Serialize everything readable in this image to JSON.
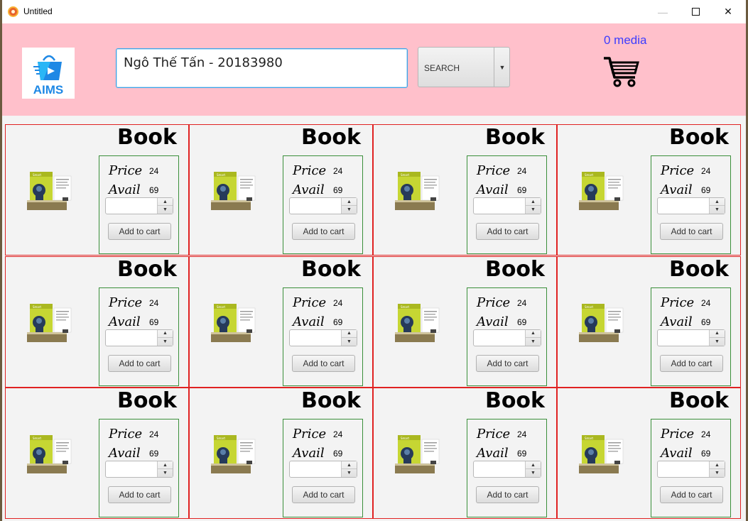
{
  "window": {
    "title": "Untitled"
  },
  "header": {
    "logo_text": "AIMS",
    "search_value": "Ngô Thế Tấn - 20183980",
    "search_button": "SEARCH",
    "media_count": "0 media"
  },
  "products": [
    {
      "title": "Book",
      "price_label": "Price",
      "price": "24",
      "avail_label": "Avail",
      "avail": "69",
      "button": "Add to cart"
    },
    {
      "title": "Book",
      "price_label": "Price",
      "price": "24",
      "avail_label": "Avail",
      "avail": "69",
      "button": "Add to cart"
    },
    {
      "title": "Book",
      "price_label": "Price",
      "price": "24",
      "avail_label": "Avail",
      "avail": "69",
      "button": "Add to cart"
    },
    {
      "title": "Book",
      "price_label": "Price",
      "price": "24",
      "avail_label": "Avail",
      "avail": "69",
      "button": "Add to cart"
    },
    {
      "title": "Book",
      "price_label": "Price",
      "price": "24",
      "avail_label": "Avail",
      "avail": "69",
      "button": "Add to cart"
    },
    {
      "title": "Book",
      "price_label": "Price",
      "price": "24",
      "avail_label": "Avail",
      "avail": "69",
      "button": "Add to cart"
    },
    {
      "title": "Book",
      "price_label": "Price",
      "price": "24",
      "avail_label": "Avail",
      "avail": "69",
      "button": "Add to cart"
    },
    {
      "title": "Book",
      "price_label": "Price",
      "price": "24",
      "avail_label": "Avail",
      "avail": "69",
      "button": "Add to cart"
    },
    {
      "title": "Book",
      "price_label": "Price",
      "price": "24",
      "avail_label": "Avail",
      "avail": "69",
      "button": "Add to cart"
    },
    {
      "title": "Book",
      "price_label": "Price",
      "price": "24",
      "avail_label": "Avail",
      "avail": "69",
      "button": "Add to cart"
    },
    {
      "title": "Book",
      "price_label": "Price",
      "price": "24",
      "avail_label": "Avail",
      "avail": "69",
      "button": "Add to cart"
    },
    {
      "title": "Book",
      "price_label": "Price",
      "price": "24",
      "avail_label": "Avail",
      "avail": "69",
      "button": "Add to cart"
    }
  ],
  "icons": {
    "logo": "shopping-bag-icon",
    "cart": "shopping-cart-icon",
    "book_cover": "book-cover-image"
  },
  "colors": {
    "header_bg": "#ffc0cb",
    "card_border": "#e02222",
    "info_border": "#3a8f3a",
    "media_count": "#3c3cff",
    "logo_blue": "#1e88e5"
  }
}
